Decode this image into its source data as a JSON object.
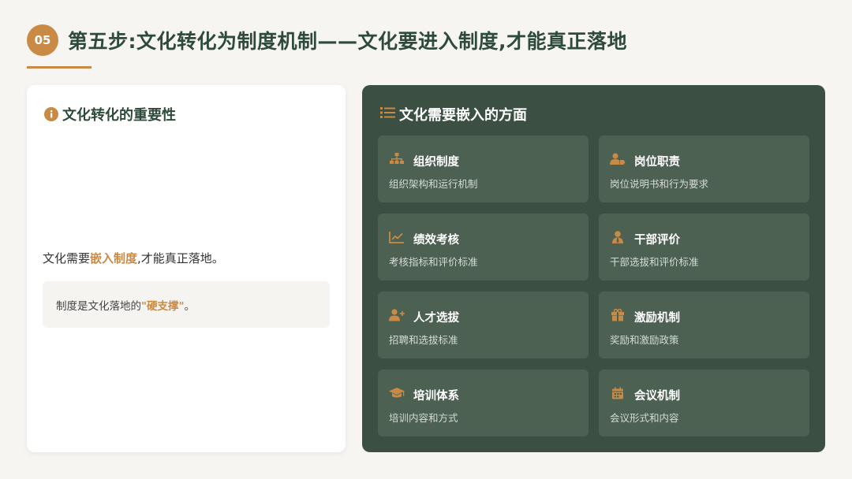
{
  "header": {
    "step": "05",
    "title": "第五步:文化转化为制度机制——文化要进入制度,才能真正落地"
  },
  "left": {
    "heading": "文化转化的重要性",
    "statement": {
      "before": "文化需要",
      "highlight": "嵌入制度",
      "after": ",才能真正落地。"
    },
    "quote": {
      "before": "制度是文化落地的",
      "highlight": "\"硬支撑\"",
      "after": "。"
    }
  },
  "right": {
    "heading": "文化需要嵌入的方面",
    "tiles": [
      {
        "icon": "org-chart-icon",
        "title": "组织制度",
        "desc": "组织架构和运行机制"
      },
      {
        "icon": "user-tag-icon",
        "title": "岗位职责",
        "desc": "岗位说明书和行为要求"
      },
      {
        "icon": "line-chart-icon",
        "title": "绩效考核",
        "desc": "考核指标和评价标准"
      },
      {
        "icon": "user-tie-icon",
        "title": "干部评价",
        "desc": "干部选拔和评价标准"
      },
      {
        "icon": "user-plus-icon",
        "title": "人才选拔",
        "desc": "招聘和选拔标准"
      },
      {
        "icon": "gift-icon",
        "title": "激励机制",
        "desc": "奖励和激励政策"
      },
      {
        "icon": "graduation-cap-icon",
        "title": "培训体系",
        "desc": "培训内容和方式"
      },
      {
        "icon": "calendar-icon",
        "title": "会议机制",
        "desc": "会议形式和内容"
      }
    ]
  },
  "colors": {
    "accent": "#c98a45",
    "dark_green": "#3b4f42",
    "tile": "#4d6153",
    "title_text": "#2e4a3b"
  }
}
